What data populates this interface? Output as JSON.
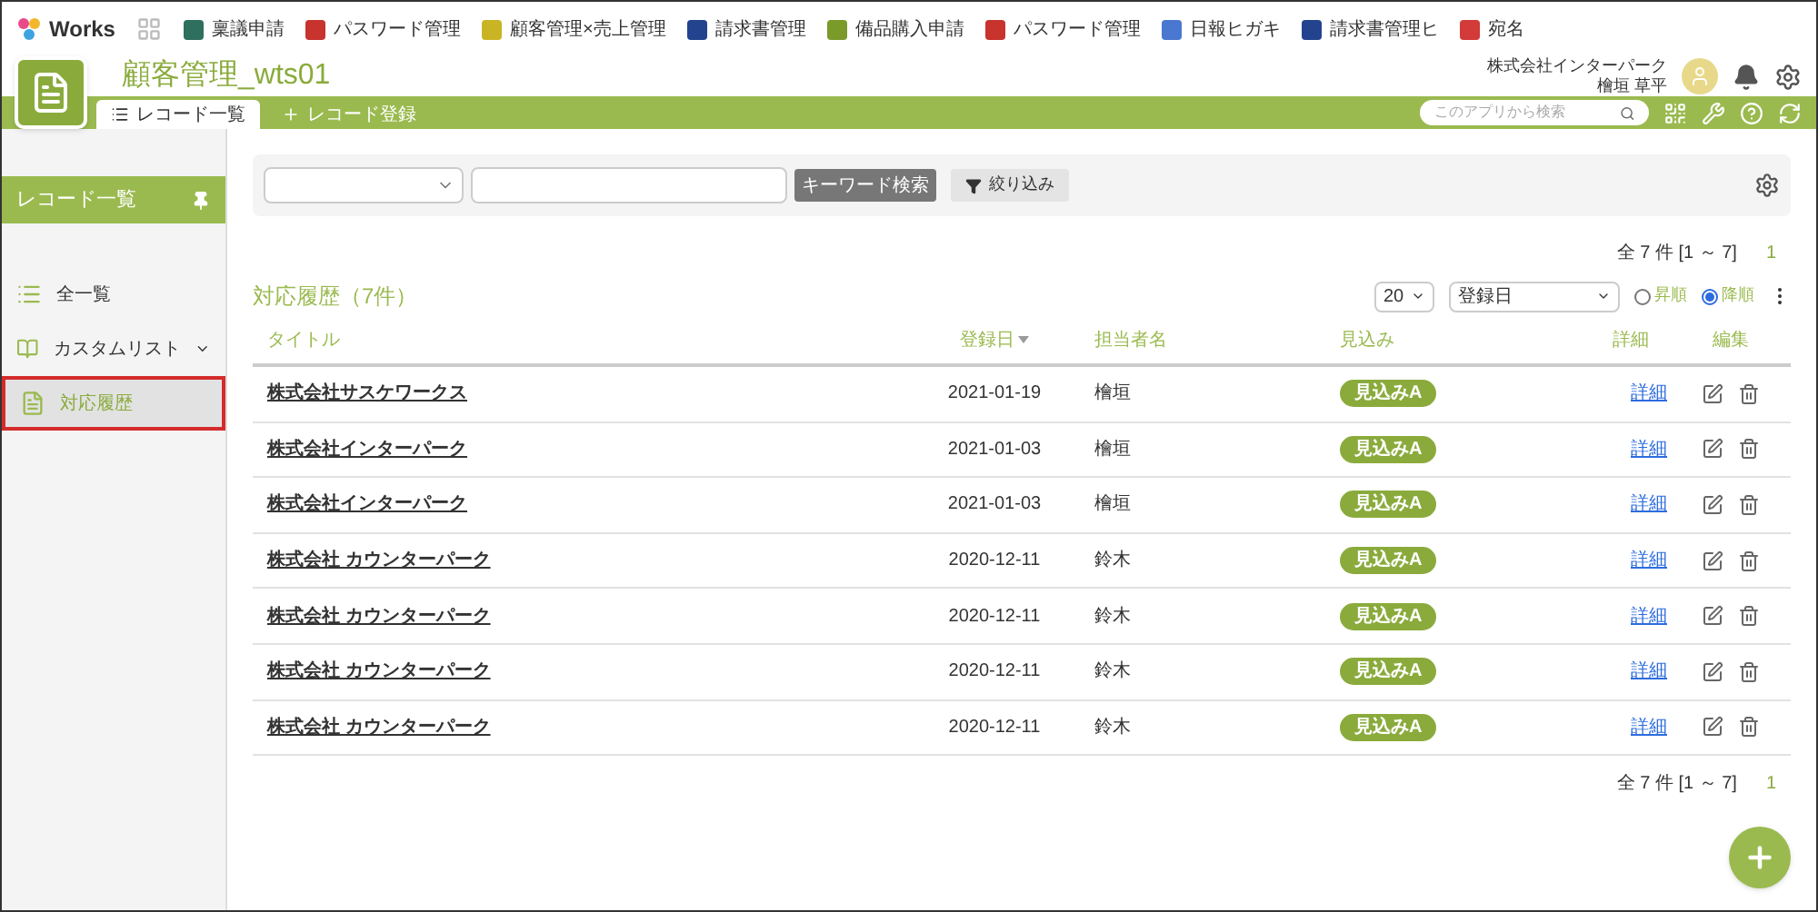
{
  "brand": {
    "name": "Works"
  },
  "bookmarks": [
    {
      "label": "稟議申請",
      "color": "#2f6f5e"
    },
    {
      "label": "パスワード管理",
      "color": "#c8332e"
    },
    {
      "label": "顧客管理×売上管理",
      "color": "#c9b524"
    },
    {
      "label": "請求書管理",
      "color": "#23438f"
    },
    {
      "label": "備品購入申請",
      "color": "#7a9a2a"
    },
    {
      "label": "パスワード管理",
      "color": "#c8332e"
    },
    {
      "label": "日報ヒガキ",
      "color": "#4a78d0"
    },
    {
      "label": "請求書管理ヒ",
      "color": "#23438f"
    },
    {
      "label": "宛名",
      "color": "#d33a3a"
    }
  ],
  "app": {
    "title": "顧客管理_wts01"
  },
  "user": {
    "company": "株式会社インターパーク",
    "name": "檜垣 草平"
  },
  "tabs": [
    {
      "label": "レコード一覧",
      "kind": "list",
      "selected": true
    },
    {
      "label": "レコード登録",
      "kind": "add",
      "selected": false
    }
  ],
  "search": {
    "placeholder": "このアプリから検索"
  },
  "sidebar": {
    "title": "レコード一覧",
    "items": [
      {
        "label": "全一覧",
        "kind": "list",
        "selected": false
      },
      {
        "label": "カスタムリスト",
        "kind": "group",
        "selected": false
      },
      {
        "label": "対応履歴",
        "kind": "doc",
        "selected": true
      }
    ]
  },
  "toolbar": {
    "keyword_button": "キーワード検索",
    "filter_button": "絞り込み"
  },
  "pager_top": {
    "count": "全 7 件 [1 ～ 7]",
    "page": "1"
  },
  "list": {
    "title": "対応履歴（7件）",
    "per_page": "20",
    "sort_field": "登録日",
    "sort_orders": [
      {
        "label": "昇順",
        "selected": false
      },
      {
        "label": "降順",
        "selected": true
      }
    ]
  },
  "table": {
    "columns": [
      {
        "label": "タイトル",
        "sorted": false
      },
      {
        "label": "登録日",
        "sorted": true
      },
      {
        "label": "担当者名",
        "sorted": false
      },
      {
        "label": "見込み",
        "sorted": false
      },
      {
        "label": "詳細",
        "sorted": false
      },
      {
        "label": "編集",
        "sorted": false
      }
    ],
    "rows": [
      {
        "title": "株式会社サスケワークス",
        "date": "2021-01-19",
        "person": "檜垣",
        "status": "見込みA",
        "detail": "詳細"
      },
      {
        "title": "株式会社インターパーク",
        "date": "2021-01-03",
        "person": "檜垣",
        "status": "見込みA",
        "detail": "詳細"
      },
      {
        "title": "株式会社インターパーク",
        "date": "2021-01-03",
        "person": "檜垣",
        "status": "見込みA",
        "detail": "詳細"
      },
      {
        "title": "株式会社 カウンターパーク",
        "date": "2020-12-11",
        "person": "鈴木",
        "status": "見込みA",
        "detail": "詳細"
      },
      {
        "title": "株式会社 カウンターパーク",
        "date": "2020-12-11",
        "person": "鈴木",
        "status": "見込みA",
        "detail": "詳細"
      },
      {
        "title": "株式会社 カウンターパーク",
        "date": "2020-12-11",
        "person": "鈴木",
        "status": "見込みA",
        "detail": "詳細"
      },
      {
        "title": "株式会社 カウンターパーク",
        "date": "2020-12-11",
        "person": "鈴木",
        "status": "見込みA",
        "detail": "詳細"
      }
    ]
  },
  "pager_bottom": {
    "count": "全 7 件 [1 ～ 7]",
    "page": "1"
  }
}
